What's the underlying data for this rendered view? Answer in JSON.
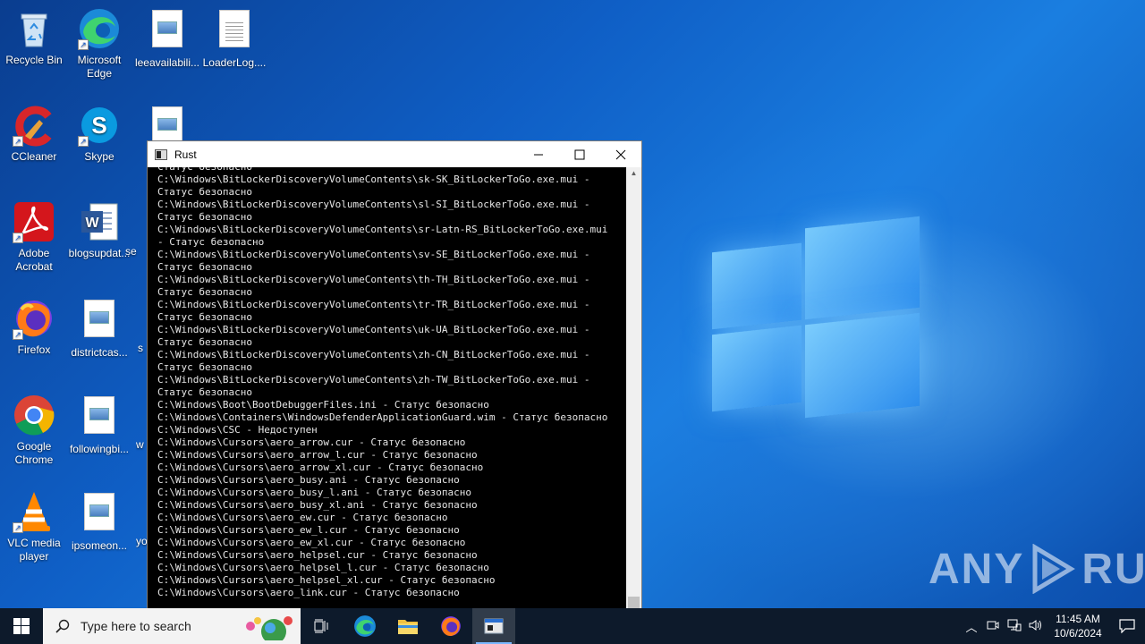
{
  "desktop": {
    "icons": [
      {
        "label": "Recycle Bin",
        "icon": "recycle-bin-icon"
      },
      {
        "label": "Microsoft Edge",
        "icon": "edge-icon"
      },
      {
        "label": "leeavailabili...",
        "icon": "image-file-icon"
      },
      {
        "label": "LoaderLog....",
        "icon": "text-file-icon"
      },
      {
        "label": "CCleaner",
        "icon": "ccleaner-icon"
      },
      {
        "label": "Skype",
        "icon": "skype-icon"
      },
      {
        "label": "Adobe Acrobat",
        "icon": "acrobat-icon"
      },
      {
        "label": "blogsupdat...",
        "icon": "word-doc-icon"
      },
      {
        "label": "Firefox",
        "icon": "firefox-icon"
      },
      {
        "label": "districtcas...",
        "icon": "image-file-icon"
      },
      {
        "label": "Google Chrome",
        "icon": "chrome-icon"
      },
      {
        "label": "followingbi...",
        "icon": "image-file-icon"
      },
      {
        "label": "VLC media player",
        "icon": "vlc-icon"
      },
      {
        "label": "ipsomeon...",
        "icon": "image-file-icon"
      }
    ],
    "partial_labels": [
      "se",
      "s",
      "w",
      "yo"
    ],
    "watermark": "ANY RUN"
  },
  "window": {
    "title": "Rust",
    "minimize": "—",
    "maximize": "☐",
    "close": "✕",
    "lines": [
      "Статус безопасно",
      "C:\\Windows\\BitLockerDiscoveryVolumeContents\\sk-SK_BitLockerToGo.exe.mui -",
      "Статус безопасно",
      "C:\\Windows\\BitLockerDiscoveryVolumeContents\\sl-SI_BitLockerToGo.exe.mui -",
      "Статус безопасно",
      "C:\\Windows\\BitLockerDiscoveryVolumeContents\\sr-Latn-RS_BitLockerToGo.exe.mui",
      "- Статус безопасно",
      "C:\\Windows\\BitLockerDiscoveryVolumeContents\\sv-SE_BitLockerToGo.exe.mui -",
      "Статус безопасно",
      "C:\\Windows\\BitLockerDiscoveryVolumeContents\\th-TH_BitLockerToGo.exe.mui -",
      "Статус безопасно",
      "C:\\Windows\\BitLockerDiscoveryVolumeContents\\tr-TR_BitLockerToGo.exe.mui -",
      "Статус безопасно",
      "C:\\Windows\\BitLockerDiscoveryVolumeContents\\uk-UA_BitLockerToGo.exe.mui -",
      "Статус безопасно",
      "C:\\Windows\\BitLockerDiscoveryVolumeContents\\zh-CN_BitLockerToGo.exe.mui -",
      "Статус безопасно",
      "C:\\Windows\\BitLockerDiscoveryVolumeContents\\zh-TW_BitLockerToGo.exe.mui -",
      "Статус безопасно",
      "C:\\Windows\\Boot\\BootDebuggerFiles.ini - Статус безопасно",
      "C:\\Windows\\Containers\\WindowsDefenderApplicationGuard.wim - Статус безопасно",
      "C:\\Windows\\CSC - Недоступен",
      "C:\\Windows\\Cursors\\aero_arrow.cur - Статус безопасно",
      "C:\\Windows\\Cursors\\aero_arrow_l.cur - Статус безопасно",
      "C:\\Windows\\Cursors\\aero_arrow_xl.cur - Статус безопасно",
      "C:\\Windows\\Cursors\\aero_busy.ani - Статус безопасно",
      "C:\\Windows\\Cursors\\aero_busy_l.ani - Статус безопасно",
      "C:\\Windows\\Cursors\\aero_busy_xl.ani - Статус безопасно",
      "C:\\Windows\\Cursors\\aero_ew.cur - Статус безопасно",
      "C:\\Windows\\Cursors\\aero_ew_l.cur - Статус безопасно",
      "C:\\Windows\\Cursors\\aero_ew_xl.cur - Статус безопасно",
      "C:\\Windows\\Cursors\\aero_helpsel.cur - Статус безопасно",
      "C:\\Windows\\Cursors\\aero_helpsel_l.cur - Статус безопасно",
      "C:\\Windows\\Cursors\\aero_helpsel_xl.cur - Статус безопасно",
      "C:\\Windows\\Cursors\\aero_link.cur - Статус безопасно"
    ]
  },
  "taskbar": {
    "search_placeholder": "Type here to search",
    "apps": [
      "task-view-icon",
      "edge-icon",
      "file-explorer-icon",
      "firefox-icon",
      "rust-console-icon"
    ],
    "active_app": "rust-console-icon",
    "time": "11:45 AM",
    "date": "10/6/2024"
  }
}
